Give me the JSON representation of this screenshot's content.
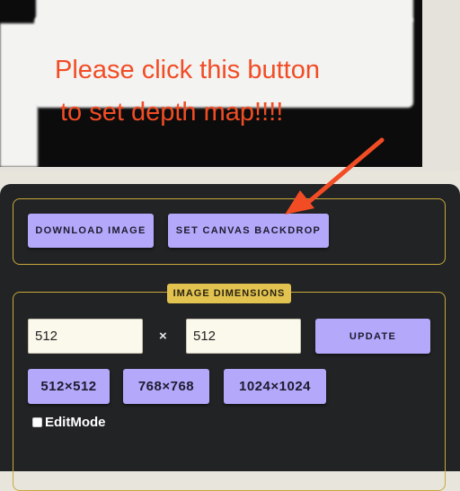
{
  "annotation": {
    "line1": "Please click this button",
    "line2": "to set depth map!!!!"
  },
  "actions": {
    "download_label": "DOWNLOAD IMAGE",
    "set_backdrop_label": "SET CANVAS BACKDROP"
  },
  "dimensions": {
    "legend": "IMAGE DIMENSIONS",
    "width_value": "512",
    "height_value": "512",
    "separator": "×",
    "update_label": "UPDATE",
    "presets": [
      "512×512",
      "768×768",
      "1024×1024"
    ]
  },
  "editmode": {
    "label": "EditMode",
    "checked": false
  },
  "colors": {
    "accent": "#b4a8fb",
    "legend": "#e2c34f",
    "border": "#c9a93a",
    "annotation": "#f24c25",
    "panel": "#222325"
  }
}
